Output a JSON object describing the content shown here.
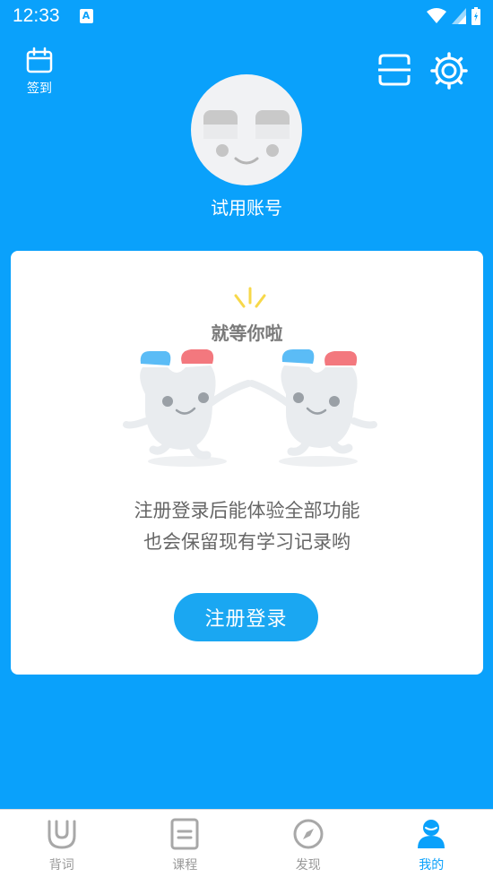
{
  "status_bar": {
    "time": "12:33",
    "app_icon_letter": "A"
  },
  "header": {
    "checkin_label": "签到",
    "username": "试用账号"
  },
  "card": {
    "waiting_title": "就等你啦",
    "message_line1": "注册登录后能体验全部功能",
    "message_line2": "也会保留现有学习记录哟",
    "register_button": "注册登录"
  },
  "tabs": [
    {
      "label": "背词",
      "icon": "u-cup-icon",
      "active": false
    },
    {
      "label": "课程",
      "icon": "book-icon",
      "active": false
    },
    {
      "label": "发现",
      "icon": "compass-icon",
      "active": false
    },
    {
      "label": "我的",
      "icon": "person-icon",
      "active": true
    }
  ],
  "colors": {
    "background": "#0aa1fb",
    "button": "#1aa7f2",
    "active_tab": "#0aa1fb",
    "inactive_tab": "#999999"
  }
}
